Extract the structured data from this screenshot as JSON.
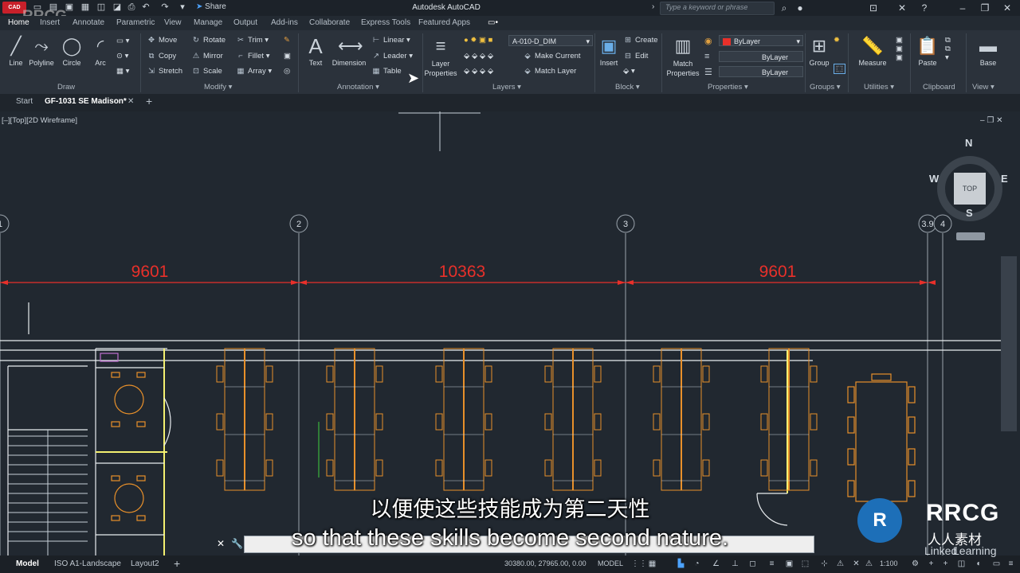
{
  "app": {
    "title": "Autodesk AutoCAD",
    "logo_text": "CAD",
    "share_label": "Share",
    "search_placeholder": "Type a keyword or phrase"
  },
  "ribbon_tabs": [
    "Home",
    "Insert",
    "Annotate",
    "Parametric",
    "View",
    "Manage",
    "Output",
    "Add-ins",
    "Collaborate",
    "Express Tools",
    "Featured Apps"
  ],
  "ribbon": {
    "draw": {
      "label": "Draw",
      "line": "Line",
      "polyline": "Polyline",
      "circle": "Circle",
      "arc": "Arc"
    },
    "modify": {
      "label": "Modify",
      "move": "Move",
      "rotate": "Rotate",
      "trim": "Trim",
      "copy": "Copy",
      "mirror": "Mirror",
      "fillet": "Fillet",
      "stretch": "Stretch",
      "scale": "Scale",
      "array": "Array"
    },
    "annotation": {
      "label": "Annotation",
      "text": "Text",
      "dimension": "Dimension",
      "linear": "Linear",
      "leader": "Leader",
      "table": "Table"
    },
    "layers": {
      "label": "Layers",
      "layer_properties": "Layer Properties",
      "current_layer": "A-010-D_DIM",
      "make_current": "Make Current",
      "match_layer": "Match Layer"
    },
    "block": {
      "label": "Block",
      "insert": "Insert",
      "create": "Create",
      "edit": "Edit"
    },
    "properties": {
      "label": "Properties",
      "match_properties": "Match Properties",
      "color": "ByLayer",
      "linetype": "ByLayer",
      "lineweight": "ByLayer"
    },
    "groups": {
      "label": "Groups",
      "group": "Group"
    },
    "utilities": {
      "label": "Utilities",
      "measure": "Measure"
    },
    "clipboard": {
      "label": "Clipboard",
      "paste": "Paste"
    },
    "view": {
      "label": "View",
      "base": "Base"
    }
  },
  "file_tabs": {
    "start": "Start",
    "drawing": "GF-1031 SE Madison*"
  },
  "viewport": {
    "label": "[–][Top][2D Wireframe]"
  },
  "viewcube": {
    "n": "N",
    "s": "S",
    "e": "E",
    "w": "W",
    "top": "TOP"
  },
  "grid_bubbles": [
    "1",
    "2",
    "3",
    "3.9",
    "4"
  ],
  "dimensions": [
    "9601",
    "10363",
    "9601"
  ],
  "subtitles": {
    "cn": "以便使这些技能成为第二天性",
    "en": "so that these skills become second nature."
  },
  "statusbar": {
    "model_tab": "Model",
    "layout1": "ISO A1-Landscape",
    "layout2": "Layout2",
    "coords": "30380.00, 27965.00, 0.00",
    "space": "MODEL",
    "scale": "1:100"
  },
  "watermarks": {
    "corner": "RRCG",
    "brand": "RRCG",
    "brand_cn": "人人素材",
    "learning": "Learning",
    "linked": "Linked"
  },
  "colors": {
    "dim_red": "#e8302a",
    "furniture_orange": "#e8902a",
    "grid_gray": "#9aa3ac",
    "wall_white": "#e9edf0",
    "wall_yellow": "#f4f070"
  }
}
